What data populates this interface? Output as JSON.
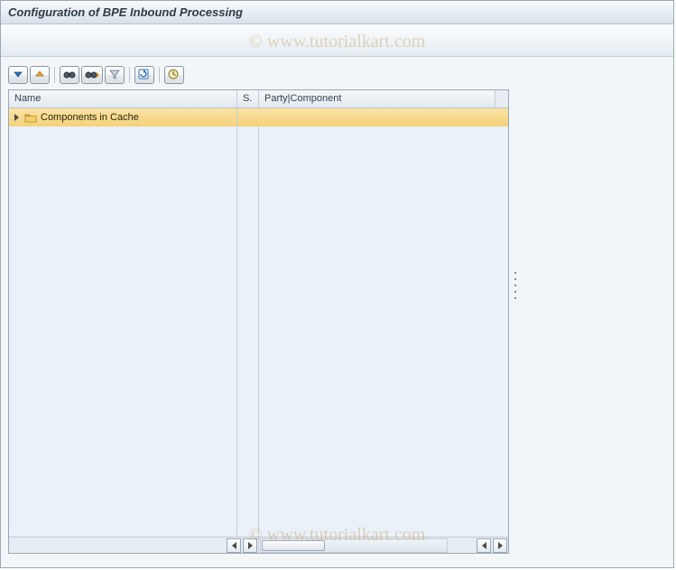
{
  "title": "Configuration of BPE Inbound Processing",
  "watermark": "© www.tutorialkart.com",
  "toolbar": {
    "expand": "Expand",
    "collapse": "Collapse",
    "find": "Find",
    "find_next": "Find Next",
    "filter": "Filter",
    "refresh": "Refresh",
    "execute": "Execute"
  },
  "columns": {
    "name": "Name",
    "s": "S.",
    "party": "Party|Component"
  },
  "tree": {
    "root": "Components in Cache"
  }
}
